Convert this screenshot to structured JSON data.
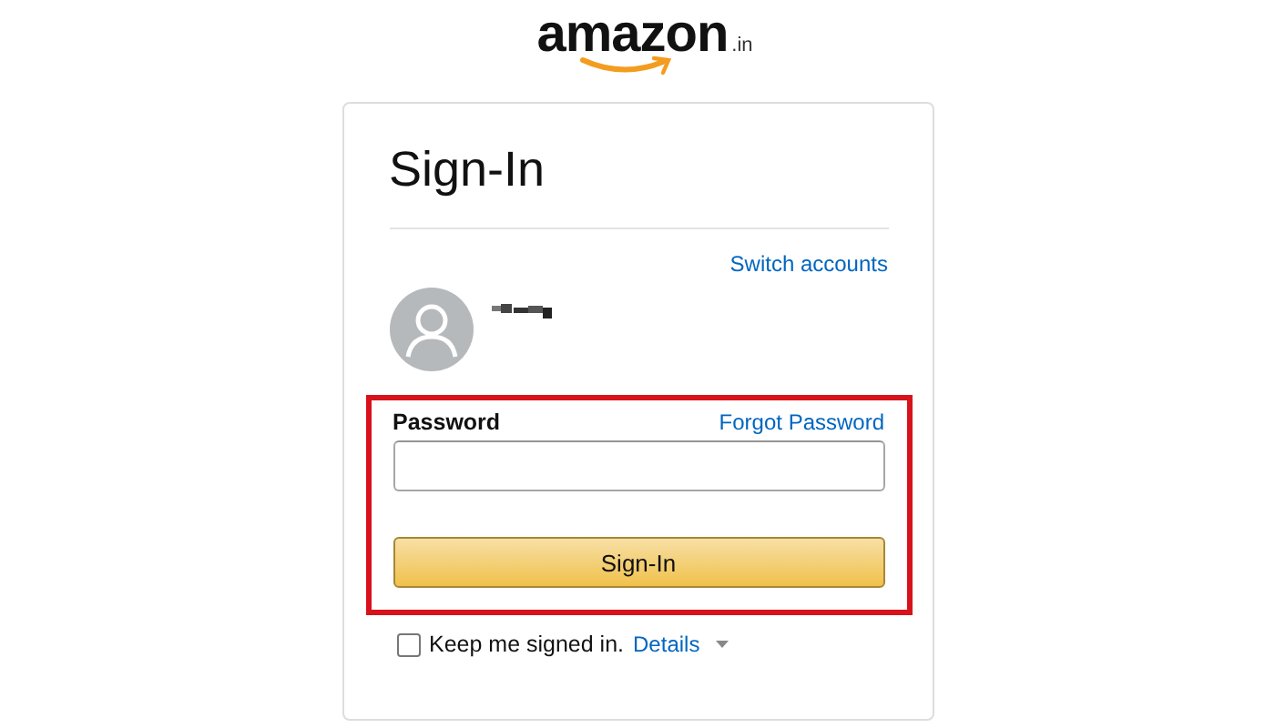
{
  "logo": {
    "wordmark": "amazon",
    "suffix": ".in"
  },
  "card": {
    "title": "Sign-In",
    "switch_link": "Switch accounts",
    "password": {
      "label": "Password",
      "forgot_link": "Forgot Password",
      "highlighted": true
    },
    "submit": "Sign-In",
    "keep_signed_in": {
      "label": "Keep me signed in.",
      "checked": false,
      "details_link": "Details"
    }
  }
}
